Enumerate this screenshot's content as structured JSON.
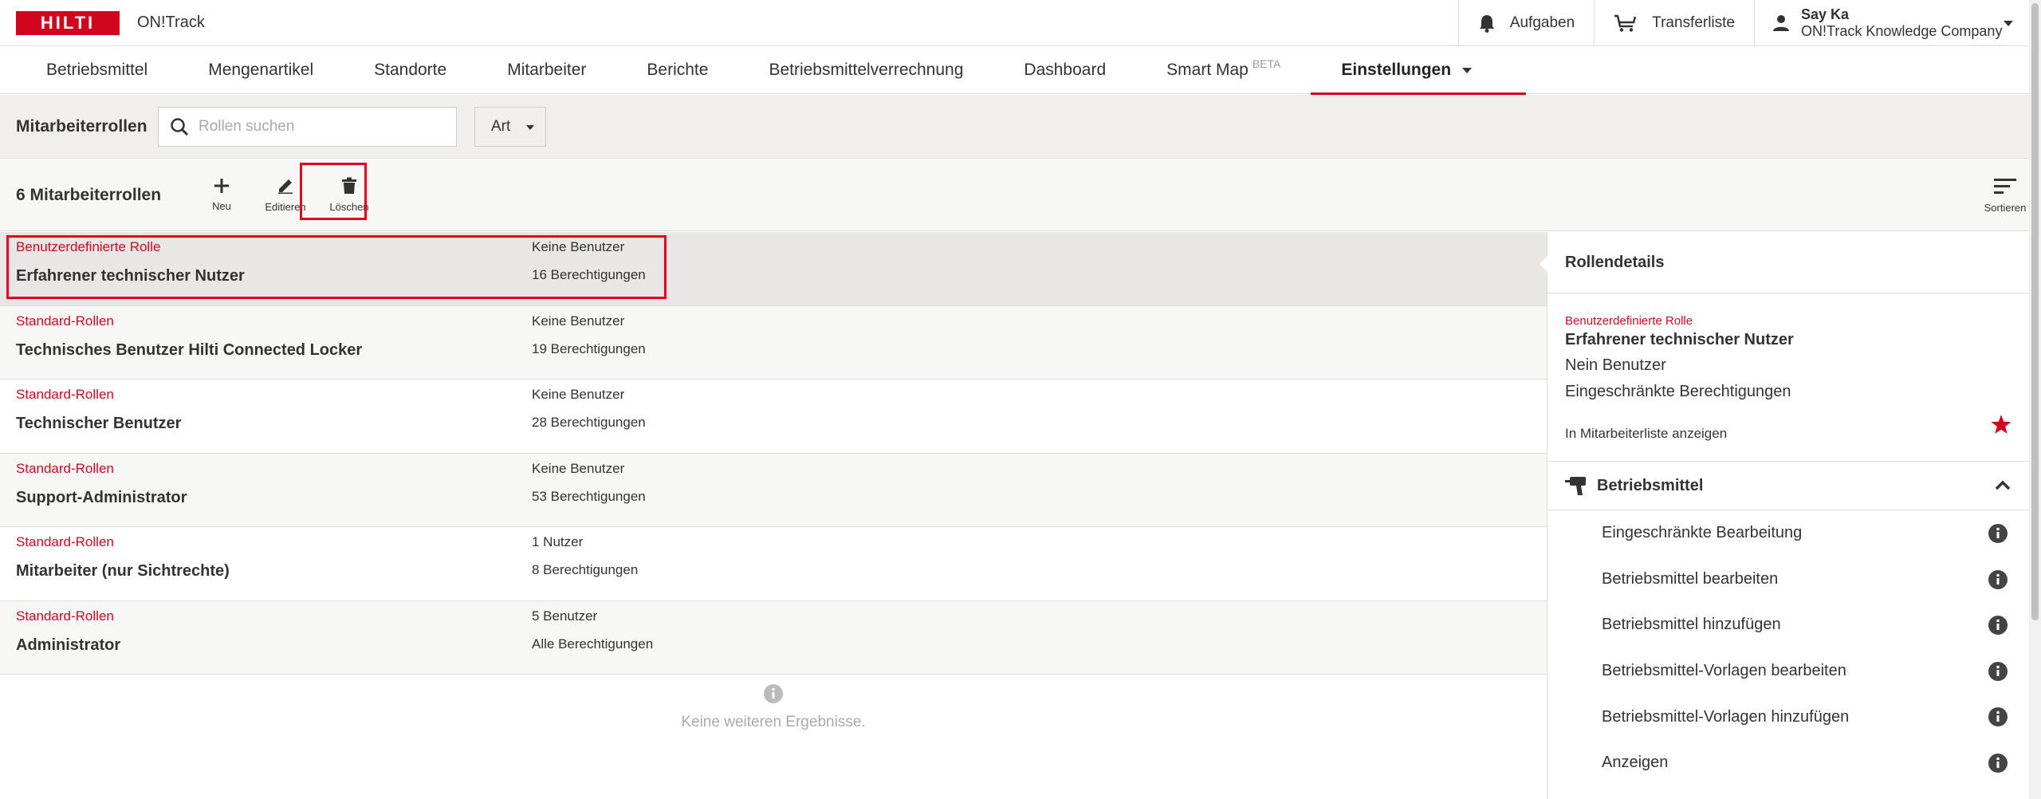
{
  "header": {
    "logo_text": "HILTI",
    "app_name": "ON!Track",
    "notifications_label": "Aufgaben",
    "transfer_label": "Transferliste",
    "user_name": "Say Ka",
    "user_company": "ON!Track Knowledge Company"
  },
  "nav": {
    "items": [
      "Betriebsmittel",
      "Mengenartikel",
      "Standorte",
      "Mitarbeiter",
      "Berichte",
      "Betriebsmittelverrechnung",
      "Dashboard",
      "Smart Map",
      "Einstellungen"
    ],
    "beta_label": "BETA"
  },
  "filter": {
    "title": "Mitarbeiterrollen",
    "search_placeholder": "Rollen suchen",
    "search_value": "",
    "art_label": "Art"
  },
  "toolbar": {
    "count_label": "6 Mitarbeiterrollen",
    "new_label": "Neu",
    "edit_label": "Editieren",
    "delete_label": "Löschen",
    "sort_label": "Sortieren"
  },
  "roles": [
    {
      "type": "Benutzerdefinierte Rolle",
      "name": "Erfahrener technischer Nutzer",
      "users": "Keine Benutzer",
      "permissions": "16 Berechtigungen"
    },
    {
      "type": "Standard-Rollen",
      "name": "Technisches Benutzer Hilti Connected Locker",
      "users": "Keine Benutzer",
      "permissions": "19 Berechtigungen"
    },
    {
      "type": "Standard-Rollen",
      "name": "Technischer Benutzer",
      "users": "Keine Benutzer",
      "permissions": "28 Berechtigungen"
    },
    {
      "type": "Standard-Rollen",
      "name": "Support-Administrator",
      "users": "Keine Benutzer",
      "permissions": "53 Berechtigungen"
    },
    {
      "type": "Standard-Rollen",
      "name": "Mitarbeiter (nur Sichtrechte)",
      "users": "1 Nutzer",
      "permissions": "8 Berechtigungen"
    },
    {
      "type": "Standard-Rollen",
      "name": "Administrator",
      "users": "5 Benutzer",
      "permissions": "Alle Berechtigungen"
    }
  ],
  "no_more_results": "Keine weiteren Ergebnisse.",
  "details": {
    "title": "Rollendetails",
    "type": "Benutzerdefinierte Rolle",
    "name": "Erfahrener technischer Nutzer",
    "users": "Nein Benutzer",
    "permissions": "Eingeschränkte Berechtigungen",
    "show_in_list": "In Mitarbeiterliste anzeigen",
    "section_title": "Betriebsmittel",
    "section_items": [
      "Eingeschränkte Bearbeitung",
      "Betriebsmittel bearbeiten",
      "Betriebsmittel hinzufügen",
      "Betriebsmittel-Vorlagen bearbeiten",
      "Betriebsmittel-Vorlagen hinzufügen",
      "Anzeigen"
    ]
  },
  "colors": {
    "brand_red": "#d2051e",
    "highlight_red": "#e3001b"
  },
  "icons": [
    "bell-icon",
    "cart-icon",
    "user-icon",
    "search-icon",
    "plus-icon",
    "pencil-icon",
    "trash-icon",
    "sort-icon",
    "star-icon",
    "drill-icon",
    "chevron-up-icon",
    "info-icon"
  ]
}
